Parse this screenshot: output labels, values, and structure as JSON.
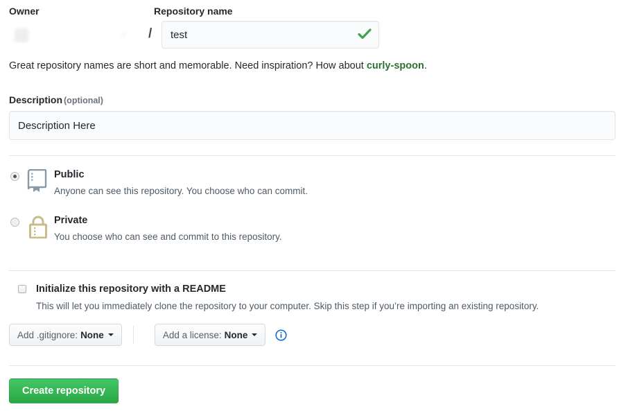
{
  "form": {
    "owner": {
      "label": "Owner",
      "selected_value": "",
      "redacted": true
    },
    "separator": "/",
    "repository_name": {
      "label": "Repository name",
      "value": "test",
      "placeholder": "",
      "valid_icon": "check-icon"
    },
    "hint": {
      "text_before": "Great repository names are short and memorable. Need inspiration? How about ",
      "suggestion": "curly-spoon",
      "text_after": "."
    },
    "description": {
      "label": "Description",
      "optional_note": "(optional)",
      "value": "Description Here",
      "placeholder": ""
    },
    "visibility": {
      "options": [
        {
          "id": "public",
          "title": "Public",
          "subtitle": "Anyone can see this repository. You choose who can commit.",
          "icon": "repo-icon",
          "selected": true
        },
        {
          "id": "private",
          "title": "Private",
          "subtitle": "You choose who can see and commit to this repository.",
          "icon": "lock-icon",
          "selected": false
        }
      ]
    },
    "readme": {
      "title": "Initialize this repository with a README",
      "subtitle": "This will let you immediately clone the repository to your computer. Skip this step if you’re importing an existing repository.",
      "checked": false
    },
    "gitignore": {
      "label": "Add .gitignore:",
      "value": "None"
    },
    "license": {
      "label": "Add a license:",
      "value": "None"
    },
    "info_icon": "info-icon",
    "submit": {
      "label": "Create repository"
    }
  },
  "colors": {
    "accent_green": "#29a745",
    "suggestion_green": "#2d7132",
    "link_blue": "#0366d6",
    "lock_khaki": "#c9bb8a",
    "repo_gray": "#8b98a5",
    "border": "#e1e4e8",
    "text": "#24292e",
    "muted_text": "#6a737d"
  }
}
